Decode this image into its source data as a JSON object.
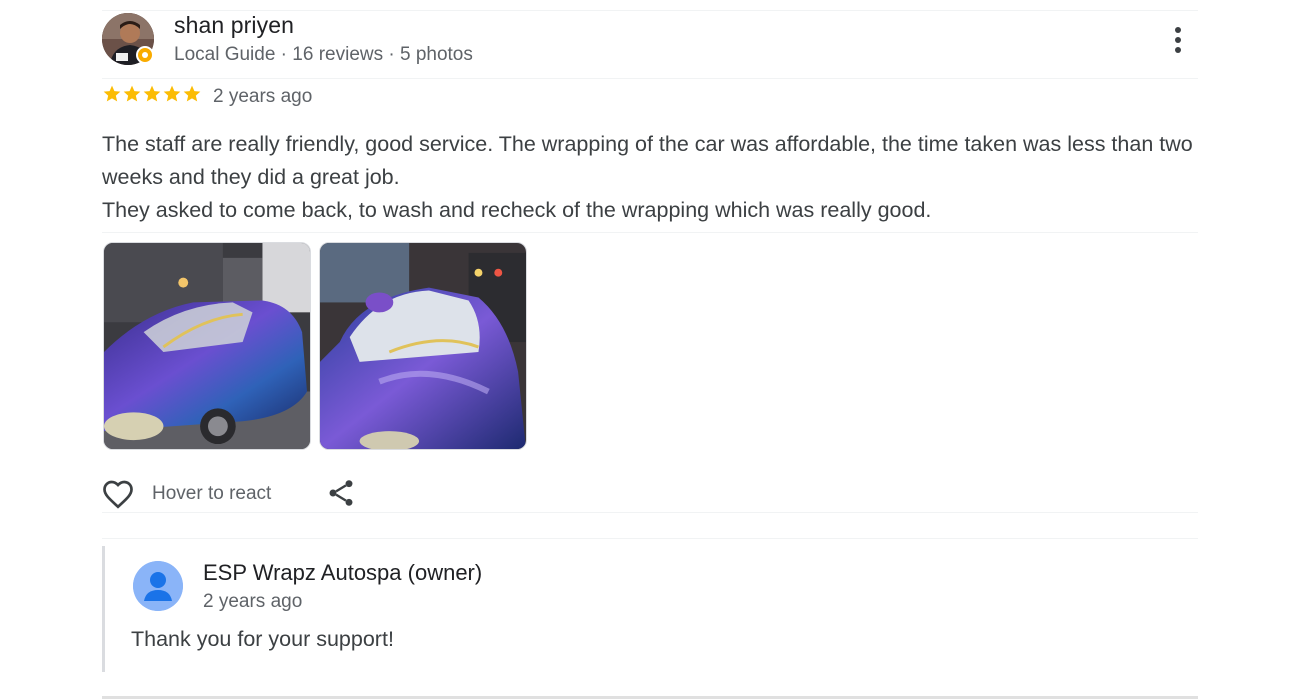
{
  "review": {
    "reviewer": {
      "name": "shan priyen",
      "meta": "Local Guide · 16 reviews · 5 photos",
      "avatar_icon": "user-photo-avatar",
      "badge_icon": "local-guide-badge-icon"
    },
    "rating": {
      "stars": 5,
      "max": 5,
      "color": "#fbbc04"
    },
    "time": "2 years ago",
    "text": [
      "The staff are really friendly, good service. The wrapping of the car was affordable, the time taken was less than two weeks and they did a great job.",
      "They asked to come back, to wash and recheck of the wrapping which was really good."
    ],
    "photos_count": 2,
    "actions": {
      "react_label": "Hover to react",
      "react_icon": "heart-outline-icon",
      "share_icon": "share-icon",
      "more_icon": "more-vert-icon"
    }
  },
  "owner_reply": {
    "name": "ESP Wrapz Autospa (owner)",
    "time": "2 years ago",
    "text": "Thank you for your support!",
    "avatar_icon": "default-person-avatar-icon"
  },
  "colors": {
    "primary_text": "#202124",
    "secondary_text": "#5f6368",
    "star": "#fbbc04",
    "reply_border": "#dadce0"
  }
}
